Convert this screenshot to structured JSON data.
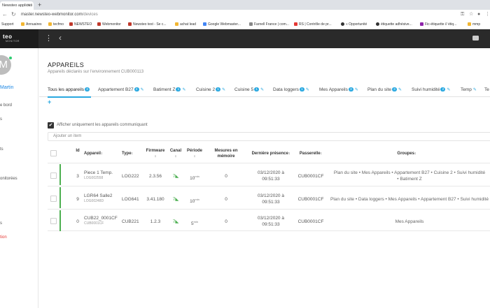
{
  "browser": {
    "tab_title": "Newsteo applicati",
    "tab_close": "×",
    "new_tab": "+",
    "url_host": "master.newsteo-webmonitor.com",
    "url_path": "/devices",
    "addr_icons": [
      "key-icon",
      "star-icon",
      "user-icon",
      "menu-icon"
    ],
    "bookmarks": [
      {
        "label": "Support",
        "color": "#ffffff"
      },
      {
        "label": "Annuaires",
        "color": "#f2b632"
      },
      {
        "label": "tecfmo",
        "color": "#f2b632"
      },
      {
        "label": "NEWSTEO",
        "color": "#c0392b"
      },
      {
        "label": "Webmonitor",
        "color": "#c0392b"
      },
      {
        "label": "Newsteo test - Se c...",
        "color": "#c0392b"
      },
      {
        "label": "achat lead",
        "color": "#f2b632"
      },
      {
        "label": "Google Webmaster...",
        "color": "#4285f4"
      },
      {
        "label": "Farnell France | com...",
        "color": "#888888"
      },
      {
        "label": "RS | Contrôle de pr...",
        "color": "#e53935"
      },
      {
        "label": "« Opportunité",
        "color": "#333333"
      },
      {
        "label": "étiquette adhésive...",
        "color": "#333333"
      },
      {
        "label": "Fic-étiquette // étiq...",
        "color": "#8e24aa"
      },
      {
        "label": "mmp",
        "color": "#f2b632"
      }
    ]
  },
  "app": {
    "logo_main": "teo",
    "logo_sub": "MONITOR",
    "kebab": "⋮",
    "back": "‹"
  },
  "sidebar": {
    "avatar_letter": "M",
    "user_name": "Martin",
    "items": [
      {
        "label": "e bord",
        "red": false
      },
      {
        "label": "s",
        "red": false
      },
      {
        "label": "ts",
        "red": false
      },
      {
        "label": "onitorées",
        "red": false
      },
      {
        "label": "s",
        "red": false
      },
      {
        "label": "tion",
        "red": true
      }
    ]
  },
  "page": {
    "title": "APPAREILS",
    "subtitle": "Appareils déclarés sur l'environnement CUB000113",
    "add": "+",
    "filter_label": "Afficher uniquement les appareils communiquant",
    "filter_check": "✔",
    "add_item_placeholder": "Ajouter un item"
  },
  "tabs": [
    {
      "label": "Tous les appareils",
      "badge": "3",
      "edit": false
    },
    {
      "label": "Appartement B27",
      "badge": "2",
      "edit": true
    },
    {
      "label": "Batiment Z",
      "badge": "1",
      "edit": true
    },
    {
      "label": "Cuisine 2",
      "badge": "1",
      "edit": true
    },
    {
      "label": "Cuisine 5",
      "badge": "1",
      "edit": true
    },
    {
      "label": "Data loggers",
      "badge": "1",
      "edit": true
    },
    {
      "label": "Mes Appareils",
      "badge": "3",
      "edit": true
    },
    {
      "label": "Plan du site",
      "badge": "3",
      "edit": true
    },
    {
      "label": "Suivi humidité",
      "badge": "2",
      "edit": true
    },
    {
      "label": "Temp",
      "badge": "",
      "edit": true
    },
    {
      "label": "Te",
      "badge": "",
      "edit": false
    }
  ],
  "table": {
    "sort_glyph": "↕",
    "headers": {
      "id": "Id",
      "appareil": "Appareil",
      "type": "Type",
      "firmware": "Firmware",
      "canal": "Canal",
      "periode": "Période",
      "mesures": "Mesures en mémoire",
      "derniere": "Dernière présence",
      "passerelle": "Passerelle",
      "groupes": "Groupes"
    },
    "rows": [
      {
        "id": "3",
        "name": "Piece 1 Temp.",
        "serial": "LOG002558",
        "type": "LOG222",
        "firmware": "2.3.56",
        "canal": "7",
        "periode": "10",
        "periode_unit": "min",
        "mesures": "0",
        "date": "03/12/2020 à",
        "time": "09:51:33",
        "passerelle": "CUB0001CF",
        "groups_1": "Plan du site • Mes Appareils • Appartement B27 • Cuisine 2 • Suivi humidité",
        "groups_2": "• Batiment Z"
      },
      {
        "id": "9",
        "name": "LGR64 Salle2",
        "serial": "LOG00248D",
        "type": "LOG641",
        "firmware": "3.41.180",
        "canal": "7",
        "periode": "10",
        "periode_unit": "min",
        "mesures": "0",
        "date": "03/12/2020 à",
        "time": "09:51:33",
        "passerelle": "CUB0001CF",
        "groups_1": "Plan du site • Data loggers • Mes Appareils • Appartement B27 • Suivi humidité",
        "groups_2": ""
      },
      {
        "id": "0",
        "name": "CUB22_0001CF",
        "serial": "CUB0001CF",
        "type": "CUB221",
        "firmware": "1.2.3",
        "canal": "7",
        "periode": "5",
        "periode_unit": "min",
        "mesures": "0",
        "date": "03/12/2020 à",
        "time": "09:51:33",
        "passerelle": "CUB0001CF",
        "groups_1": "Mes Appareils",
        "groups_2": ""
      }
    ]
  }
}
